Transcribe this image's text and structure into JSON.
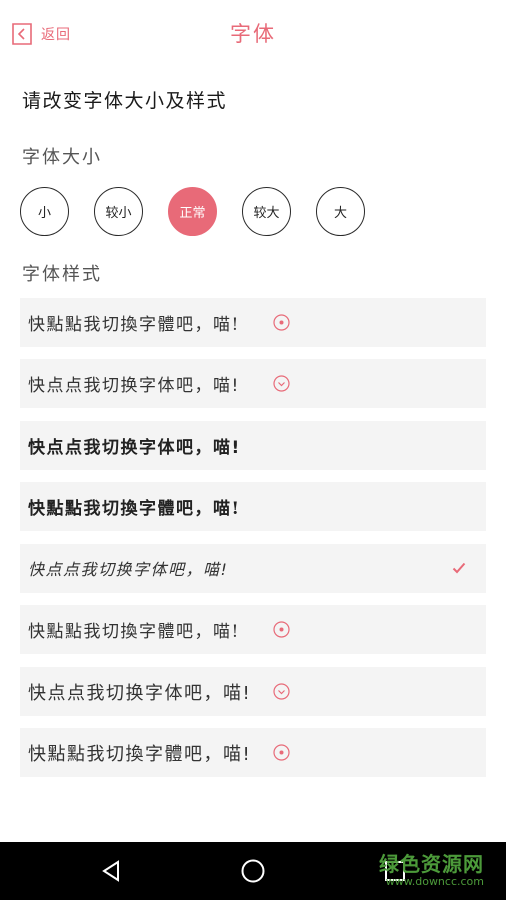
{
  "header": {
    "back_label": "返回",
    "title": "字体"
  },
  "prompt": "请改变字体大小及样式",
  "size_section": {
    "label": "字体大小",
    "options": [
      "小",
      "较小",
      "正常",
      "较大",
      "大"
    ],
    "selected": "正常"
  },
  "style_section": {
    "label": "字体样式",
    "items": [
      {
        "text": "快點點我切換字體吧，喵!",
        "status": "download"
      },
      {
        "text": "快点点我切换字体吧，喵!",
        "status": "download"
      },
      {
        "text": "快点点我切换字体吧，喵!",
        "status": "installed"
      },
      {
        "text": "快點點我切換字體吧，喵!",
        "status": "installed"
      },
      {
        "text": "快点点我切换字体吧，喵!",
        "status": "selected"
      },
      {
        "text": "快點點我切換字體吧，喵!",
        "status": "download"
      },
      {
        "text": "快点点我切换字体吧，喵!",
        "status": "download"
      },
      {
        "text": "快點點我切換字體吧，喵!",
        "status": "download"
      }
    ]
  },
  "colors": {
    "accent": "#e86a78",
    "row_bg": "#f4f4f4",
    "navbar": "#000000"
  },
  "icons": {
    "back": "back-chevron-icon",
    "download": "download-circle-icon",
    "check": "check-icon"
  },
  "navbar": {
    "buttons": [
      "back-triangle-icon",
      "home-circle-icon",
      "recents-square-icon"
    ]
  },
  "watermark": {
    "main": "绿色资源网",
    "sub": "www.downcc.com"
  }
}
